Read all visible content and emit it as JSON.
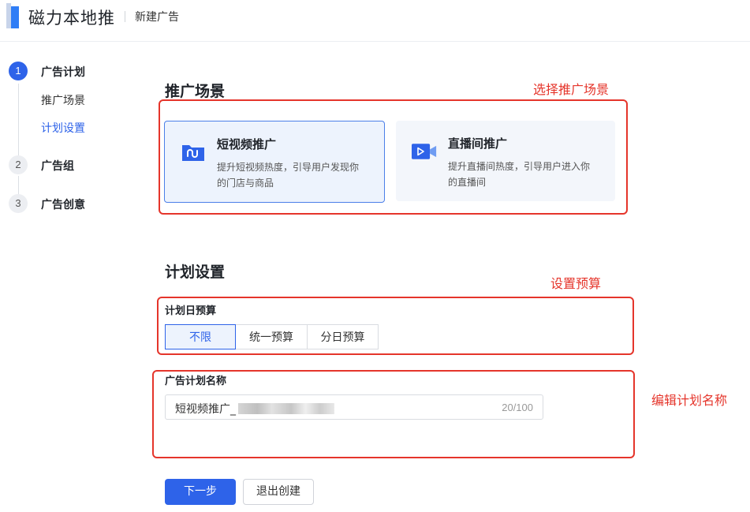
{
  "header": {
    "app_title": "磁力本地推",
    "breadcrumb": "新建广告"
  },
  "steps": [
    {
      "num": "1",
      "label": "广告计划",
      "subs": [
        "推广场景",
        "计划设置"
      ],
      "current_sub": "计划设置"
    },
    {
      "num": "2",
      "label": "广告组"
    },
    {
      "num": "3",
      "label": "广告创意"
    }
  ],
  "scene": {
    "title": "推广场景",
    "cards": [
      {
        "title": "短视频推广",
        "desc": "提升短视频热度，引导用户发现你的门店与商品",
        "icon": "short-video-icon",
        "selected": true
      },
      {
        "title": "直播间推广",
        "desc": "提升直播间热度，引导用户进入你的直播间",
        "icon": "live-room-icon",
        "selected": false
      }
    ]
  },
  "plan": {
    "title": "计划设置",
    "budget_label": "计划日预算",
    "budget_options": [
      "不限",
      "统一预算",
      "分日预算"
    ],
    "budget_selected": "不限",
    "name_label": "广告计划名称",
    "name_value": "短视频推广_",
    "name_count": "20/100"
  },
  "annotations": {
    "scene": "选择推广场景",
    "budget": "设置预算",
    "name": "编辑计划名称"
  },
  "actions": {
    "next": "下一步",
    "exit": "退出创建"
  },
  "colors": {
    "primary": "#2e63e9",
    "annotation": "#e5352b"
  }
}
